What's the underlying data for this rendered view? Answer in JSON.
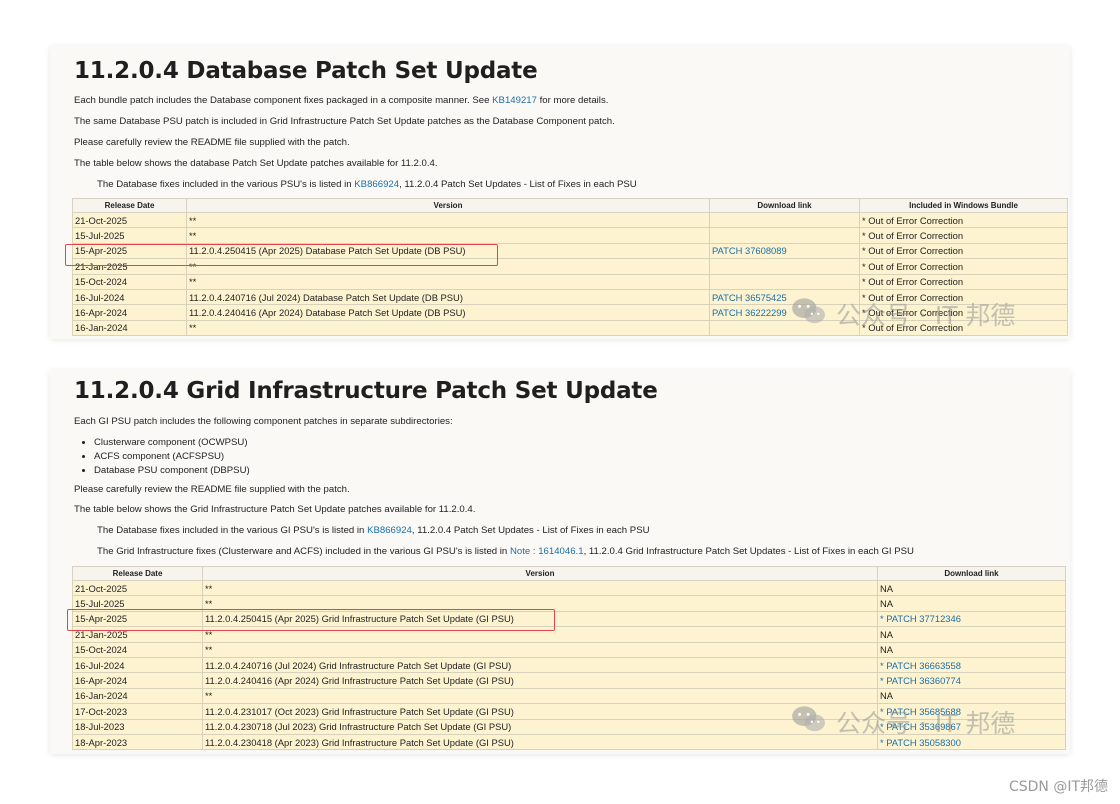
{
  "db_section": {
    "title": "11.2.0.4 Database Patch Set Update",
    "p1_before": "Each bundle patch includes the Database component fixes packaged in a composite manner. See ",
    "p1_link": "KB149217",
    "p1_after": " for more details.",
    "p2": "The same Database PSU patch is included in Grid Infrastructure Patch Set Update patches as the Database Component patch.",
    "p3": "Please carefully review the README file supplied with the patch.",
    "p4": "The table below shows the database Patch Set Update patches available for 11.2.0.4.",
    "p5_before": "The Database fixes included in the various PSU's is listed in ",
    "p5_link": "KB866924",
    "p5_after": ", 11.2.0.4 Patch Set Updates - List of Fixes in each PSU",
    "headers": [
      "Release Date",
      "Version",
      "Download link",
      "Included in Windows Bundle"
    ],
    "rows": [
      {
        "date": "21-Oct-2025",
        "version": "**",
        "link": "",
        "windows": "* Out of Error Correction"
      },
      {
        "date": "15-Jul-2025",
        "version": "**",
        "link": "",
        "windows": "* Out of Error Correction"
      },
      {
        "date": "15-Apr-2025",
        "version": "11.2.0.4.250415 (Apr 2025) Database Patch Set Update (DB PSU)",
        "link": "PATCH 37608089",
        "windows": "* Out of Error Correction"
      },
      {
        "date": "21-Jan-2025",
        "version": "**",
        "link": "",
        "windows": "* Out of Error Correction"
      },
      {
        "date": "15-Oct-2024",
        "version": "**",
        "link": "",
        "windows": "* Out of Error Correction"
      },
      {
        "date": "16-Jul-2024",
        "version": "11.2.0.4.240716 (Jul 2024) Database Patch Set Update (DB PSU)",
        "link": "PATCH 36575425",
        "windows": "* Out of Error Correction"
      },
      {
        "date": "16-Apr-2024",
        "version": "11.2.0.4.240416 (Apr 2024) Database Patch Set Update (DB PSU)",
        "link": "PATCH 36222299",
        "windows": "* Out of Error Correction"
      },
      {
        "date": "16-Jan-2024",
        "version": "**",
        "link": "",
        "windows": "* Out of Error Correction"
      }
    ]
  },
  "gi_section": {
    "title": "11.2.0.4 Grid Infrastructure Patch Set Update",
    "p1": "Each GI PSU patch includes the following component patches in separate subdirectories:",
    "bullets": [
      "Clusterware component (OCWPSU)",
      "ACFS component (ACFSPSU)",
      "Database PSU component (DBPSU)"
    ],
    "p2": "Please carefully review the README file supplied with the patch.",
    "p3": "The table below shows the Grid Infrastructure Patch Set Update patches available for 11.2.0.4.",
    "p4_before": "The Database fixes included in the various GI PSU's is listed in ",
    "p4_link": "KB866924",
    "p4_after": ", 11.2.0.4 Patch Set Updates - List of Fixes in each PSU",
    "p5_before": "The Grid Infrastructure fixes (Clusterware and ACFS) included in the various GI PSU's is listed in ",
    "p5_link": "Note : 1614046.1",
    "p5_after": ", 11.2.0.4 Grid Infrastructure Patch Set Updates - List of Fixes in each GI PSU",
    "headers": [
      "Release Date",
      "Version",
      "Download link"
    ],
    "rows": [
      {
        "date": "21-Oct-2025",
        "version": "**",
        "link": "NA"
      },
      {
        "date": "15-Jul-2025",
        "version": "**",
        "link": "NA"
      },
      {
        "date": "15-Apr-2025",
        "version": "11.2.0.4.250415 (Apr 2025) Grid Infrastructure Patch Set Update (GI PSU)",
        "link": "* PATCH 37712346"
      },
      {
        "date": "21-Jan-2025",
        "version": "**",
        "link": "NA"
      },
      {
        "date": "15-Oct-2024",
        "version": "**",
        "link": "NA"
      },
      {
        "date": "16-Jul-2024",
        "version": "11.2.0.4.240716 (Jul 2024) Grid Infrastructure Patch Set Update (GI PSU)",
        "link": "* PATCH 36663558"
      },
      {
        "date": "16-Apr-2024",
        "version": "11.2.0.4.240416 (Apr 2024) Grid Infrastructure Patch Set Update (GI PSU)",
        "link": "* PATCH 36360774"
      },
      {
        "date": "16-Jan-2024",
        "version": "**",
        "link": "NA"
      },
      {
        "date": "17-Oct-2023",
        "version": "11.2.0.4.231017 (Oct 2023) Grid Infrastructure Patch Set Update (GI PSU)",
        "link": "* PATCH 35685688"
      },
      {
        "date": "18-Jul-2023",
        "version": "11.2.0.4.230718 (Jul 2023) Grid Infrastructure Patch Set Update (GI PSU)",
        "link": "* PATCH 35369867"
      },
      {
        "date": "18-Apr-2023",
        "version": "11.2.0.4.230418 (Apr 2023) Grid Infrastructure Patch Set Update (GI PSU)",
        "link": "* PATCH 35058300"
      }
    ]
  },
  "watermark": {
    "text": "公众号 · IT 邦德",
    "icon": "wechat-icon"
  },
  "footer": {
    "csdn": "CSDN @IT邦德"
  },
  "colors": {
    "row_bg": "#fdf3d0",
    "link": "#1a6fa8",
    "highlight": "#e0474c"
  }
}
